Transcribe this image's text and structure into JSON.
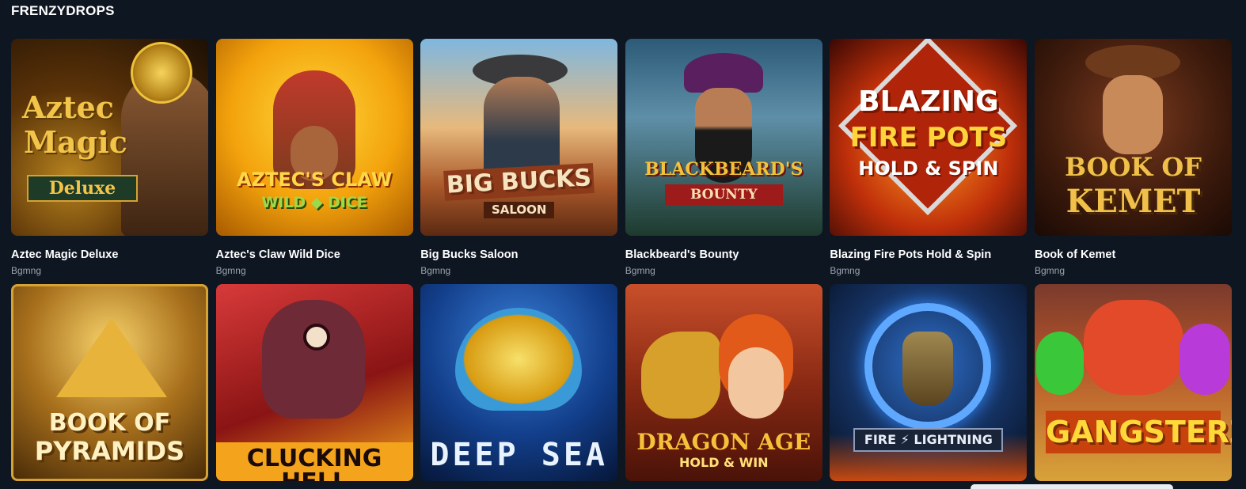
{
  "section": {
    "title": "FRENZYDROPS"
  },
  "games": [
    {
      "title": "Aztec Magic Deluxe",
      "provider": "Bgmng",
      "logo_line1": "Aztec",
      "logo_line2": "Magic",
      "logo_line3": "Deluxe",
      "icon": "aztec-warrior-icon"
    },
    {
      "title": "Aztec's Claw Wild Dice",
      "provider": "Bgmng",
      "logo_line1": "AZTEC'S CLAW",
      "logo_line2": "WILD ◆ DICE",
      "icon": "aztec-woman-icon"
    },
    {
      "title": "Big Bucks Saloon",
      "provider": "Bgmng",
      "logo_line1": "BIG BUCKS",
      "logo_line2": "SALOON",
      "icon": "cowboy-icon"
    },
    {
      "title": "Blackbeard's Bounty",
      "provider": "Bgmng",
      "logo_line1": "BLACKBEARD'S",
      "logo_line2": "BOUNTY",
      "icon": "pirate-icon"
    },
    {
      "title": "Blazing Fire Pots Hold & Spin",
      "provider": "Bgmng",
      "logo_line1": "BLAZING",
      "logo_line2": "FIRE POTS",
      "logo_line3": "HOLD & SPIN",
      "icon": "flame-icon"
    },
    {
      "title": "Book of Kemet",
      "provider": "Bgmng",
      "logo_line1": "BOOK OF",
      "logo_line2": "KEMET",
      "icon": "explorer-icon"
    },
    {
      "logo_line1": "BOOK OF",
      "logo_line2": "PYRAMIDS",
      "icon": "pyramid-icon"
    },
    {
      "logo_line1": "CLUCKING HELL",
      "icon": "devil-chicken-icon"
    },
    {
      "logo_line1": "DEEP SEA",
      "icon": "jellyfish-icon"
    },
    {
      "logo_line1": "DRAGON AGE",
      "logo_line2": "HOLD & WIN",
      "icon": "dragon-icon"
    },
    {
      "logo_line1": "FIRE ⚡ LIGHTNING",
      "icon": "thor-mask-icon"
    },
    {
      "logo_line1": "GANGSTERZ",
      "icon": "monster-icon"
    }
  ],
  "colors": {
    "background": "#0e1621",
    "title": "#ffffff",
    "provider": "#9aa3ad"
  }
}
